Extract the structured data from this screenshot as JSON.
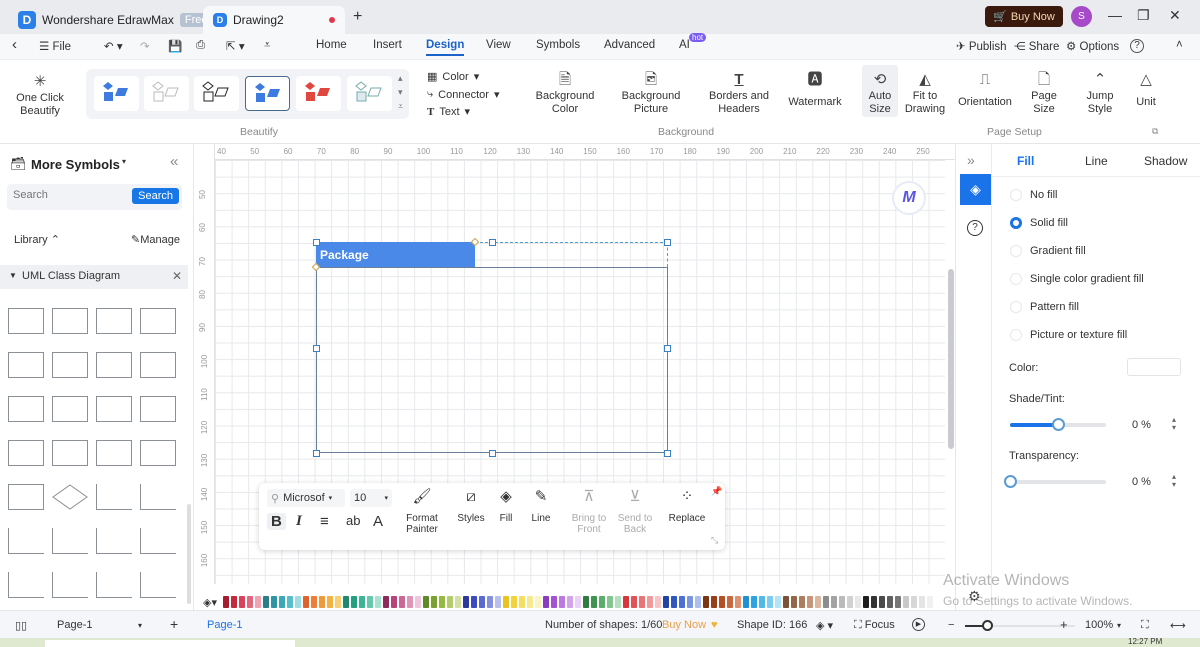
{
  "titlebar": {
    "app_name": "Wondershare EdrawMax",
    "plan_badge": "Free",
    "doc_tab": "Drawing2",
    "new_tab": "+",
    "buy_now": "Buy Now",
    "avatar_initial": "S",
    "min": "—",
    "restore": "❐",
    "close": "✕"
  },
  "menubar": {
    "back": "‹",
    "file": "File",
    "tabs": [
      "Home",
      "Insert",
      "Design",
      "View",
      "Symbols",
      "Advanced",
      "AI"
    ],
    "active_tab": "Design",
    "ai_badge": "hot",
    "publish": "Publish",
    "share": "Share",
    "options": "Options",
    "help": "?"
  },
  "ribbon": {
    "beautify": {
      "one_click": "One Click Beautify",
      "group_label": "Beautify",
      "color": "Color",
      "connector": "Connector",
      "text": "Text",
      "selected_style_index": 3
    },
    "background": {
      "group_label": "Background",
      "items": [
        "Background Color",
        "Background Picture",
        "Borders and Headers",
        "Watermark"
      ]
    },
    "page_setup": {
      "group_label": "Page Setup",
      "items": [
        "Auto Size",
        "Fit to Drawing",
        "Orientation",
        "Page Size",
        "Jump Style",
        "Unit"
      ]
    }
  },
  "left_panel": {
    "title": "More Symbols",
    "search_placeholder": "Search",
    "search_button": "Search",
    "library": "Library",
    "manage": "Manage",
    "library_name": "UML Class Diagram"
  },
  "canvas": {
    "ruler_top": [
      "40",
      "50",
      "60",
      "70",
      "80",
      "90",
      "100",
      "110",
      "120",
      "130",
      "140",
      "150",
      "160",
      "170",
      "180",
      "190",
      "200",
      "210",
      "220",
      "230",
      "240",
      "250"
    ],
    "ruler_left": [
      "50",
      "60",
      "70",
      "80",
      "90",
      "100",
      "110",
      "120",
      "130",
      "140",
      "150",
      "160"
    ],
    "shape_label": "Package"
  },
  "floating_toolbar": {
    "font": "Microsof",
    "size": "10",
    "bold": "B",
    "italic": "I",
    "align": "≡",
    "ab": "ab",
    "fontcolor": "A",
    "format_painter": "Format Painter",
    "styles": "Styles",
    "fill": "Fill",
    "line": "Line",
    "bring_front": "Bring to Front",
    "send_back": "Send to Back",
    "replace": "Replace"
  },
  "right_panel": {
    "tabs": [
      "Fill",
      "Line",
      "Shadow"
    ],
    "active_tab": "Fill",
    "fill_options": [
      "No fill",
      "Solid fill",
      "Gradient fill",
      "Single color gradient fill",
      "Pattern fill",
      "Picture or texture fill"
    ],
    "selected_fill": "Solid fill",
    "color_label": "Color:",
    "shade_label": "Shade/Tint:",
    "shade_value": "0 %",
    "shade_fraction": 0.5,
    "transparency_label": "Transparency:",
    "transparency_value": "0 %",
    "transparency_fraction": 0
  },
  "palette": [
    "#a61e2d",
    "#c42a3b",
    "#d9425a",
    "#e3677c",
    "#f0a3b0",
    "#2b7d8a",
    "#2f95a3",
    "#3aa8b6",
    "#56bfcb",
    "#9fdde4",
    "#e0632d",
    "#ee7d35",
    "#f29a3a",
    "#f5b23f",
    "#f8cf74",
    "#1f8a6d",
    "#22a080",
    "#3bb593",
    "#67c9ac",
    "#a9e2cf",
    "#8e2b5c",
    "#b8427a",
    "#cd6597",
    "#df94b8",
    "#f0c6da",
    "#5e8a24",
    "#7aa12f",
    "#94b93f",
    "#b2cc6b",
    "#d2e0a3",
    "#2c3a9e",
    "#3c4cc0",
    "#5a6ad2",
    "#8591e0",
    "#b8bfef",
    "#e9c320",
    "#f2d43a",
    "#f5df62",
    "#f7e98f",
    "#faf3c2",
    "#8a3cc2",
    "#a352d6",
    "#bb77e2",
    "#d3a3ee",
    "#e9d1f7",
    "#2f7d3e",
    "#3f9550",
    "#5aad6a",
    "#83c690",
    "#b5deBD",
    "#d8363a",
    "#e25256",
    "#ea7376",
    "#f19a9c",
    "#f7c3c4",
    "#2243a6",
    "#3056c2",
    "#4c70d6",
    "#7a96e2",
    "#acbeef",
    "#7a3512",
    "#973f18",
    "#b35124",
    "#c8693f",
    "#dd9370",
    "#1f8fd6",
    "#2ea3e3",
    "#50b8ea",
    "#7ccdf0",
    "#b2e3f7",
    "#7a5238",
    "#94664a",
    "#ae7d60",
    "#c6967a",
    "#ddb69f",
    "#8c8c8c",
    "#a3a3a3",
    "#bababa",
    "#d1d1d1",
    "#e8e8e8",
    "#1e1e1e",
    "#333333",
    "#4a4a4a",
    "#606060",
    "#777777",
    "#c8c8c8",
    "#d7d7d7",
    "#e4e4e4",
    "#f0f0f0"
  ],
  "statusbar": {
    "page_select": "Page-1",
    "add_page": "+",
    "page_tab": "Page-1",
    "shapes_count": "Number of shapes: 1/60",
    "buy_now": "Buy Now",
    "shape_id": "Shape ID: 166",
    "focus": "Focus",
    "zoom": "100%",
    "zoom_minus": "−",
    "zoom_plus": "+"
  },
  "os": {
    "activate_title": "Activate Windows",
    "activate_sub": "Go to Settings to activate Windows.",
    "clock": "12:27 PM"
  },
  "colors": {
    "accent": "#1a73e8",
    "shape_header": "#4a89e8",
    "buy_now_bg": "#3a1a0c"
  }
}
